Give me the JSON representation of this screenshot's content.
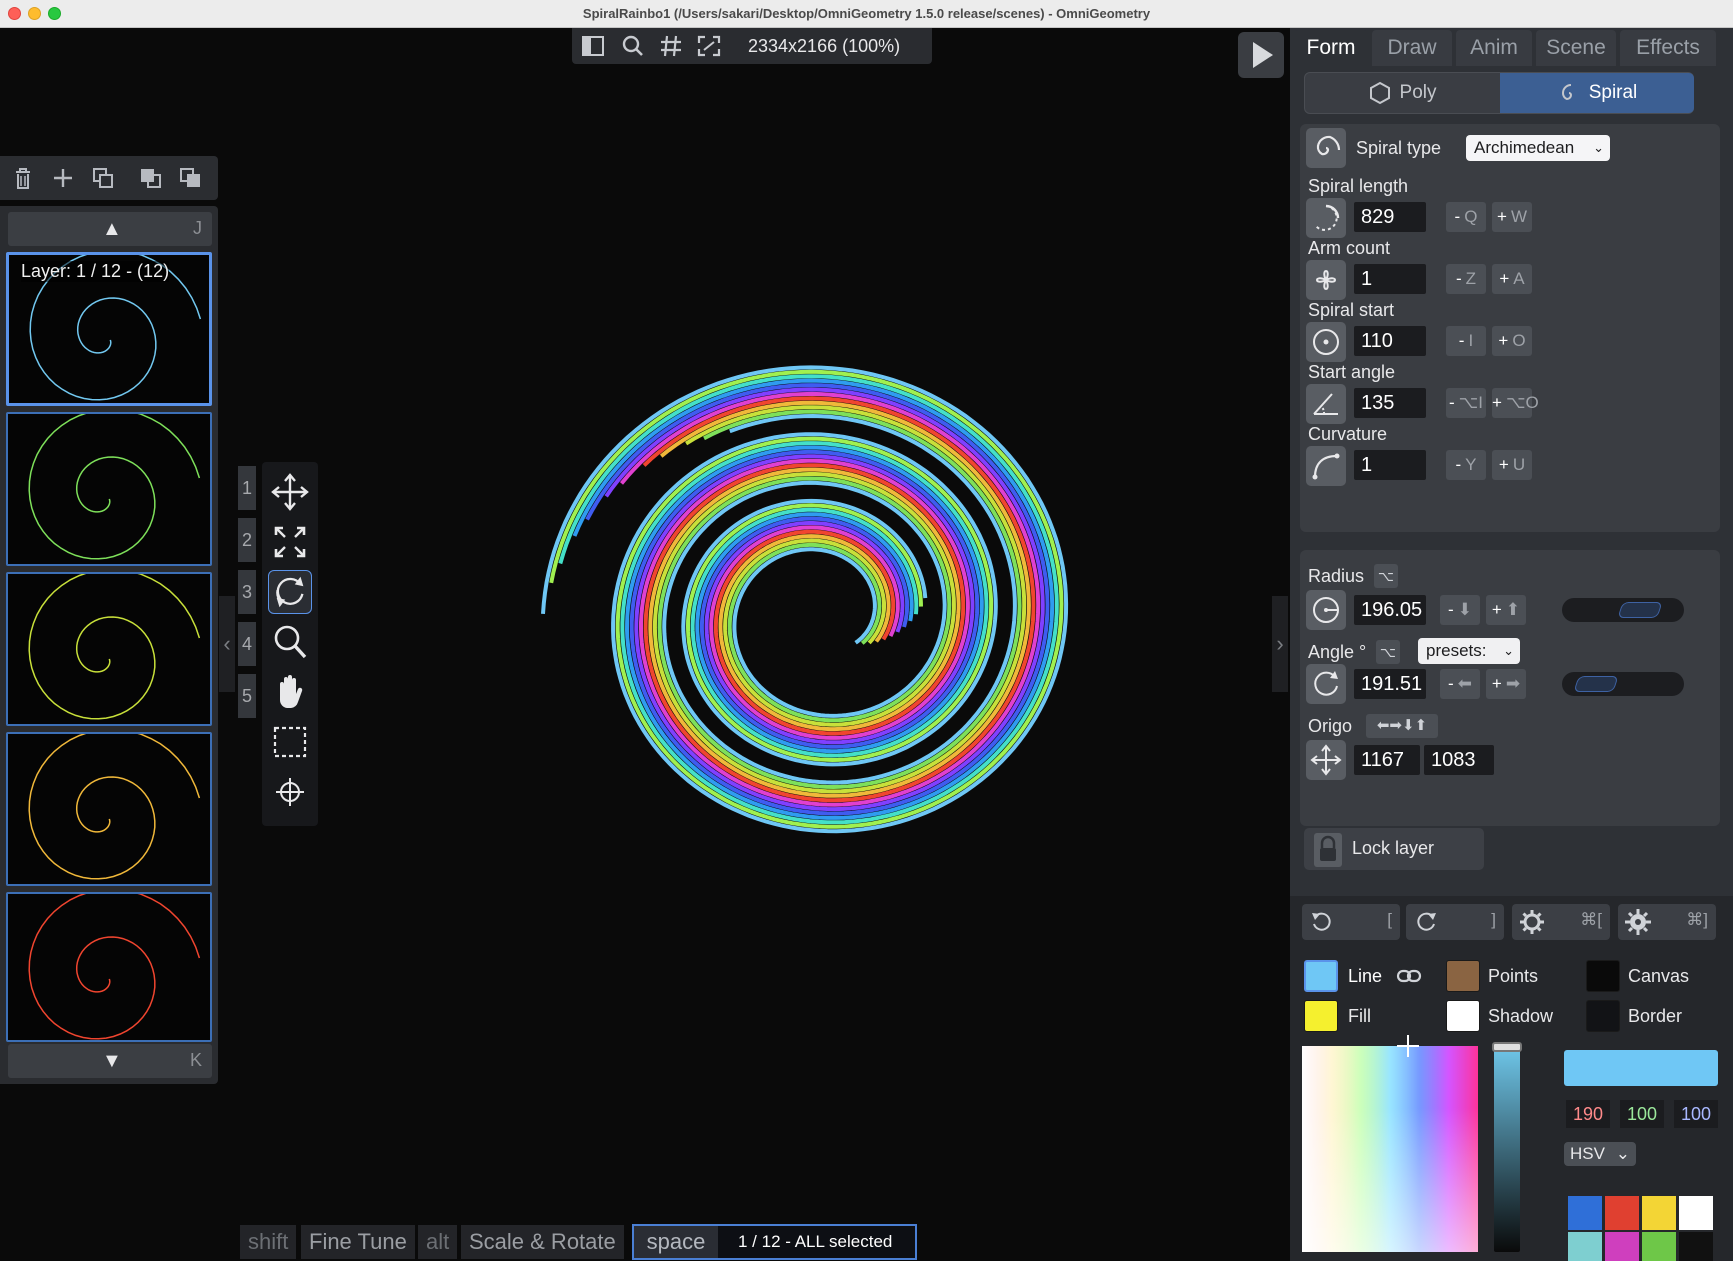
{
  "window": {
    "title": "SpiralRainbo1 (/Users/sakari/Desktop/OmniGeometry 1.5.0 release/scenes) - OmniGeometry"
  },
  "topbar": {
    "icons": [
      "sidebar-icon",
      "search-icon",
      "grid-icon",
      "fit-icon"
    ],
    "zoom_info": "2334x2166 (100%)"
  },
  "layers": {
    "toolbar_icons": [
      "trash-icon",
      "plus-icon",
      "duplicate-icon",
      "move-up-icon",
      "move-down-icon"
    ],
    "scroll_up_key": "J",
    "scroll_down_key": "K",
    "selected_label": "Layer: 1 / 12 - (12)",
    "thumb_colors": [
      "#72c8f0",
      "#7ee05a",
      "#c8e03a",
      "#f0b83a",
      "#f0452f"
    ]
  },
  "tools": {
    "numbers": [
      "1",
      "2",
      "3",
      "4",
      "5"
    ],
    "icons": [
      "move-icon",
      "scale-icon",
      "rotate-icon",
      "zoom-icon",
      "hand-icon",
      "selection-icon",
      "crosshair-icon"
    ]
  },
  "status": {
    "shift_key": "shift",
    "shift_label": "Fine Tune",
    "alt_key": "alt",
    "alt_label": "Scale & Rotate",
    "space_key": "space",
    "selection": "1 / 12 - ALL selected"
  },
  "panel": {
    "tabs": [
      "Form",
      "Draw",
      "Anim",
      "Scene",
      "Effects"
    ],
    "mode": {
      "poly": "Poly",
      "spiral": "Spiral"
    },
    "spiral_type_label": "Spiral type",
    "spiral_type_value": "Archimedean",
    "params": [
      {
        "label": "Spiral length",
        "value": "829",
        "minus_key": "Q",
        "plus_key": "W",
        "icon": "spiral-length-icon"
      },
      {
        "label": "Arm count",
        "value": "1",
        "minus_key": "Z",
        "plus_key": "A",
        "icon": "arm-count-icon"
      },
      {
        "label": "Spiral start",
        "value": "110",
        "minus_key": "I",
        "plus_key": "O",
        "icon": "spiral-start-icon"
      },
      {
        "label": "Start angle",
        "value": "135",
        "minus_key": "⌥I",
        "plus_key": "⌥O",
        "icon": "start-angle-icon"
      },
      {
        "label": "Curvature",
        "value": "1",
        "minus_key": "Y",
        "plus_key": "U",
        "icon": "curvature-icon"
      }
    ],
    "radius_label": "Radius",
    "radius_value": "196.05",
    "angle_label": "Angle °",
    "angle_value": "191.51",
    "angle_presets": "presets:",
    "origo_label": "Origo",
    "origo_x": "1167",
    "origo_y": "1083",
    "lock_label": "Lock layer"
  },
  "colors": {
    "rotate_keys": [
      "[",
      "]",
      "⌘[",
      "⌘]"
    ],
    "line_label": "Line",
    "fill_label": "Fill",
    "points_label": "Points",
    "shadow_label": "Shadow",
    "canvas_label": "Canvas",
    "border_label": "Border",
    "line_color": "#6fc7f5",
    "fill_color": "#f5f02e",
    "points_color": "#8a6442",
    "shadow_color": "#ffffff",
    "canvas_color": "#0a0a0a",
    "border_color": "#121316",
    "h": "190",
    "s": "100",
    "v": "100",
    "model": "HSV",
    "palette": [
      "#2f6fd8",
      "#e04030",
      "#f3d535",
      "#ffffff",
      "#7ecfd0",
      "#cf3fbe",
      "#6ec748",
      "#111111"
    ]
  }
}
